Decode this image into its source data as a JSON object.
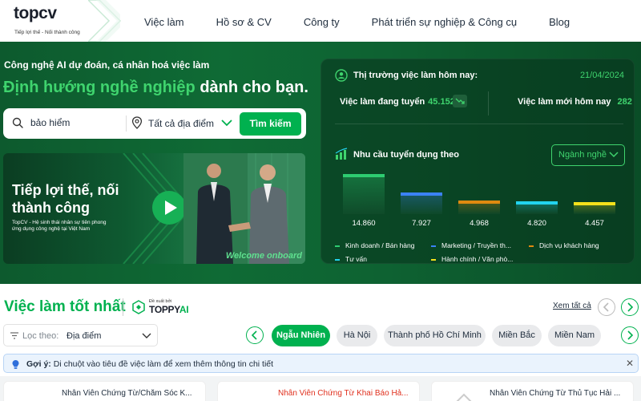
{
  "brand": {
    "logo_top": "top",
    "logo_cv": "cv",
    "tagline": "Tiếp lợi thế - Nối thành công",
    "accent": "#00b14f"
  },
  "nav": {
    "items": [
      "Việc làm",
      "Hồ sơ & CV",
      "Công ty",
      "Phát triển sự nghiệp & Công cụ",
      "Blog"
    ]
  },
  "hero": {
    "subtitle": "Công nghệ AI dự đoán, cá nhân hoá việc làm",
    "title_highlight": "Định hướng nghề nghiệp",
    "title_rest": " dành cho bạn.",
    "search": {
      "keyword": "bảo hiểm",
      "location": "Tất cả địa điểm",
      "button": "Tìm kiếm"
    },
    "banner": {
      "title": "Tiếp lợi thế, nối thành công",
      "description": "TopCV - Hệ sinh thái nhân sự tiên phong ứng dụng công nghệ tại Việt Nam",
      "overlay_text": "Welcome onboard"
    }
  },
  "market": {
    "title": "Thị trường việc làm hôm nay:",
    "date": "21/04/2024",
    "jobs_active_label": "Việc làm đang tuyển",
    "jobs_active_value": "45.152",
    "jobs_new_label": "Việc làm mới hôm nay",
    "jobs_new_value": "282",
    "demand_title": "Nhu cầu tuyển dụng theo",
    "demand_select": "Ngành nghề"
  },
  "chart_data": {
    "type": "bar",
    "categories": [
      "Kinh doanh / Bán hàng",
      "Marketing / Truyền th...",
      "Dịch vụ khách hàng",
      "Tư vấn",
      "Hành chính / Văn phò..."
    ],
    "values": [
      14860,
      7927,
      4968,
      4820,
      4457
    ],
    "value_labels": [
      "14.860",
      "7.927",
      "4.968",
      "4.820",
      "4.457"
    ],
    "colors": [
      "#2ecc71",
      "#3b82f6",
      "#e08a10",
      "#22d3ee",
      "#f5e11b"
    ],
    "legend_labels": [
      "Kinh doanh / Bán hàng",
      "Marketing / Truyền th...",
      "Dịch vụ khách hàng",
      "Tư vấn",
      "Hành chính / Văn phò..."
    ]
  },
  "best_jobs": {
    "title": "Việc làm tốt nhất",
    "suggested_by": "Đề xuất bởi",
    "toppy": "TOPPY",
    "toppy_ai": "AI",
    "see_all": "Xem tất cả",
    "filter_label": "Lọc theo:",
    "filter_value": "Địa điểm",
    "chips": [
      "Ngẫu Nhiên",
      "Hà Nội",
      "Thành phố Hồ Chí Minh",
      "Miền Bắc",
      "Miền Nam"
    ],
    "tip_bold": "Gợi ý:",
    "tip_text": " Di chuột vào tiêu đề việc làm để xem thêm thông tin chi tiết",
    "tip_close": "✕",
    "cards": [
      "Nhân Viên Chứng Từ/Chăm Sóc K...",
      "Nhân Viên Chứng Từ Khai Báo Hả...",
      "Nhân Viên Chứng Từ Thủ Tục Hải ..."
    ]
  }
}
